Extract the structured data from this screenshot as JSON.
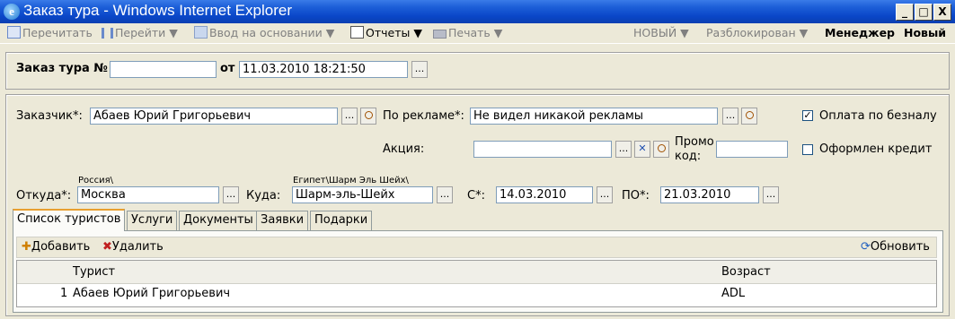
{
  "window": {
    "title": "Заказ тура - Windows Internet Explorer",
    "min": "_",
    "max": "□",
    "close": "X"
  },
  "toolbar": {
    "reread": "Перечитать",
    "goto": "Перейти ▼",
    "base": "Ввод на основании ▼",
    "reports": "Отчеты ▼",
    "print": "Печать ▼",
    "status_new": "НОВЫЙ ▼",
    "status_unlocked": "Разблокирован ▼",
    "role": "Менеджер",
    "state": "Новый"
  },
  "header": {
    "order_label": "Заказ тура №",
    "order_value": "",
    "from_label": "от",
    "date_value": "11.03.2010 18:21:50"
  },
  "form": {
    "customer_label": "Заказчик*:",
    "customer_value": "Абаев Юрий Григорьевич",
    "ad_label": "По рекламе*:",
    "ad_value": "Не видел никакой рекламы",
    "cashless_label": "Оплата по безналу",
    "cashless_checked": true,
    "action_label": "Акция:",
    "action_value": "",
    "promo_label_1": "Промо",
    "promo_label_2": "код:",
    "promo_value": "",
    "credit_label": "Оформлен кредит",
    "credit_checked": false,
    "from_label": "Откуда*:",
    "from_hint": "Россия\\",
    "from_value": "Москва",
    "to_label": "Куда:",
    "to_hint": "Египет\\Шарм Эль Шейх\\",
    "to_value": "Шарм-эль-Шейх",
    "date_from_label": "С*:",
    "date_from_value": "14.03.2010",
    "date_to_label": "ПО*:",
    "date_to_value": "21.03.2010",
    "dots": "..."
  },
  "tabs": [
    "Список туристов",
    "Услуги",
    "Документы",
    "Заявки",
    "Подарки"
  ],
  "list_toolbar": {
    "add": "Добавить",
    "delete": "Удалить",
    "refresh": "Обновить"
  },
  "table": {
    "columns": [
      "Турист",
      "Возраст"
    ],
    "rows": [
      {
        "n": "1",
        "tourist": "Абаев Юрий Григорьевич",
        "age": "ADL"
      }
    ]
  }
}
